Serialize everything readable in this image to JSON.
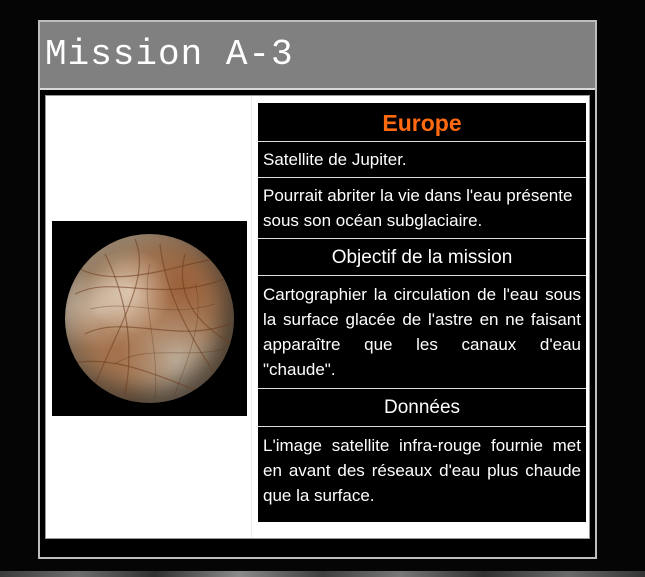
{
  "header": {
    "title": "Mission A-3"
  },
  "image": {
    "icon": "europa-planet-image"
  },
  "info": {
    "name": "Europe",
    "name_color": "#ff6a10",
    "subtitle": "Satellite de Jupiter.",
    "description": "Pourrait abriter la vie dans l'eau présente sous son océan subglaciaire.",
    "objective_heading": "Objectif de la mission",
    "objective_text": "Cartographier la circulation de l'eau sous la surface glacée de l'astre en ne faisant apparaître que les canaux d'eau \"chaude\".",
    "data_heading": "Données",
    "data_text": "L'image satellite infra-rouge fournie met en avant des réseaux d'eau plus chaude que la surface."
  }
}
